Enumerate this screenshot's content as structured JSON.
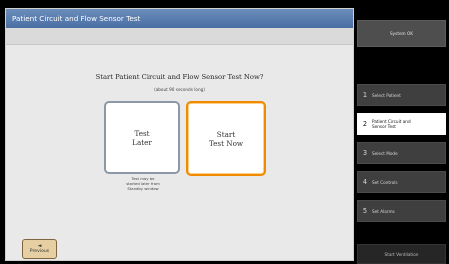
{
  "main": {
    "title": "Patient Circuit and Flow Sensor Test",
    "question": "Start Patient Circuit and Flow Sensor Test Now?",
    "duration": "(about 90 seconds long)",
    "test_later": {
      "label": "Test\nLater"
    },
    "start_test": {
      "label": "Start\nTest Now"
    },
    "later_note": "Test may be\nstarted later from\nStandby window",
    "previous": {
      "arrow": "◄",
      "label": "Previous"
    }
  },
  "side": {
    "system_status": "System OK",
    "steps": [
      {
        "num": "1",
        "label": "Select Patient"
      },
      {
        "num": "2",
        "label": "Patient Circuit and\nSensor Test"
      },
      {
        "num": "3",
        "label": "Select Mode"
      },
      {
        "num": "4",
        "label": "Set Controls"
      },
      {
        "num": "5",
        "label": "Set Alarms"
      }
    ],
    "start_ventilation": "Start Ventilation"
  },
  "colors": {
    "title_bar": "#5a7eb0",
    "accent_orange": "#f08a00",
    "active_step": "#ffffff"
  }
}
